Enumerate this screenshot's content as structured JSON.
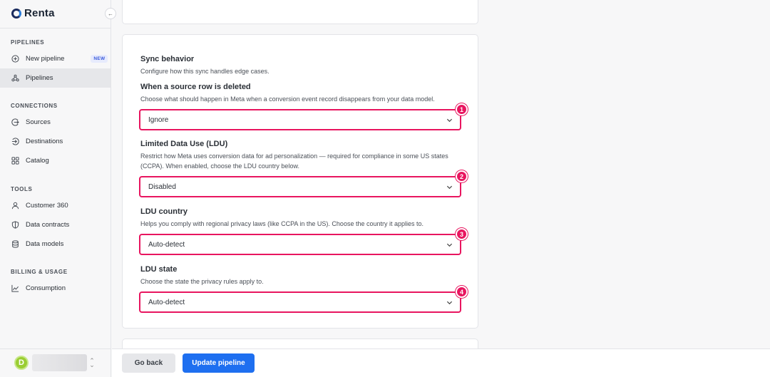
{
  "brand": {
    "name": "Renta"
  },
  "sidebar": {
    "sections": [
      {
        "title": "PIPELINES",
        "items": [
          {
            "label": "New pipeline",
            "icon": "plus-circle-icon",
            "badge": "NEW"
          },
          {
            "label": "Pipelines",
            "icon": "pipelines-icon",
            "active": true
          }
        ]
      },
      {
        "title": "CONNECTIONS",
        "items": [
          {
            "label": "Sources",
            "icon": "source-icon"
          },
          {
            "label": "Destinations",
            "icon": "destination-icon"
          },
          {
            "label": "Catalog",
            "icon": "catalog-icon"
          }
        ]
      },
      {
        "title": "TOOLS",
        "items": [
          {
            "label": "Customer 360",
            "icon": "user-icon"
          },
          {
            "label": "Data contracts",
            "icon": "shield-icon"
          },
          {
            "label": "Data models",
            "icon": "database-icon"
          }
        ]
      },
      {
        "title": "BILLING & USAGE",
        "items": [
          {
            "label": "Consumption",
            "icon": "chart-icon"
          }
        ]
      }
    ],
    "user": {
      "initial": "D"
    }
  },
  "sync": {
    "title": "Sync behavior",
    "description": "Configure how this sync handles edge cases.",
    "fields": [
      {
        "label": "When a source row is deleted",
        "help": "Choose what should happen in Meta when a conversion event record disappears from your data model.",
        "value": "Ignore",
        "step": "1"
      },
      {
        "label": "Limited Data Use (LDU)",
        "help": "Restrict how Meta uses conversion data for ad personalization — required for compliance in some US states (CCPA). When enabled, choose the LDU country below.",
        "value": "Disabled",
        "step": "2"
      },
      {
        "label": "LDU country",
        "help": "Helps you comply with regional privacy laws (like CCPA in the US). Choose the country it applies to.",
        "value": "Auto-detect",
        "step": "3"
      },
      {
        "label": "LDU state",
        "help": "Choose the state the privacy rules apply to.",
        "value": "Auto-detect",
        "step": "4"
      }
    ]
  },
  "actions": {
    "back": "Go back",
    "update": "Update pipeline"
  },
  "colors": {
    "accent": "#1e6ff0",
    "highlight": "#e8155f"
  }
}
